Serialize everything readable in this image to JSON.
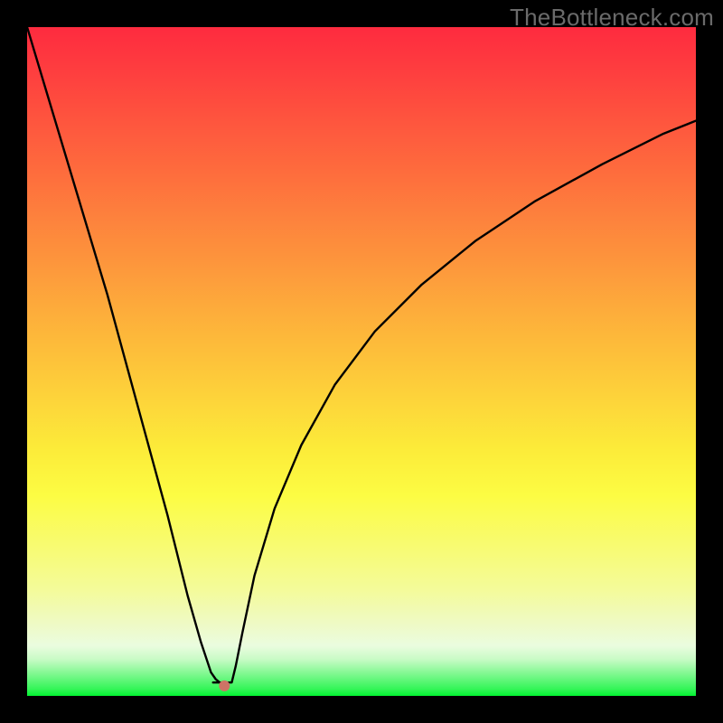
{
  "watermark": "TheBottleneck.com",
  "colors": {
    "frame": "#000000",
    "curve": "#000000",
    "marker": "#cd7466"
  },
  "chart_data": {
    "type": "line",
    "title": "",
    "xlabel": "",
    "ylabel": "",
    "xlim": [
      0,
      1
    ],
    "ylim": [
      0,
      1
    ],
    "minimum_x": 0.29,
    "marker": {
      "x": 0.295,
      "y": 0.985,
      "color": "#cd7466"
    },
    "series": [
      {
        "name": "left-branch",
        "x": [
          0.0,
          0.03,
          0.06,
          0.09,
          0.12,
          0.15,
          0.18,
          0.21,
          0.24,
          0.26,
          0.275,
          0.282,
          0.288
        ],
        "y": [
          0.0,
          0.1,
          0.2,
          0.3,
          0.4,
          0.51,
          0.62,
          0.73,
          0.85,
          0.92,
          0.965,
          0.975,
          0.98
        ]
      },
      {
        "name": "plateau",
        "x": [
          0.278,
          0.306
        ],
        "y": [
          0.98,
          0.98
        ]
      },
      {
        "name": "right-branch",
        "x": [
          0.306,
          0.312,
          0.322,
          0.34,
          0.37,
          0.41,
          0.46,
          0.52,
          0.59,
          0.67,
          0.76,
          0.86,
          0.95,
          1.0
        ],
        "y": [
          0.98,
          0.955,
          0.905,
          0.82,
          0.72,
          0.625,
          0.535,
          0.455,
          0.385,
          0.32,
          0.26,
          0.205,
          0.16,
          0.14
        ]
      }
    ]
  }
}
